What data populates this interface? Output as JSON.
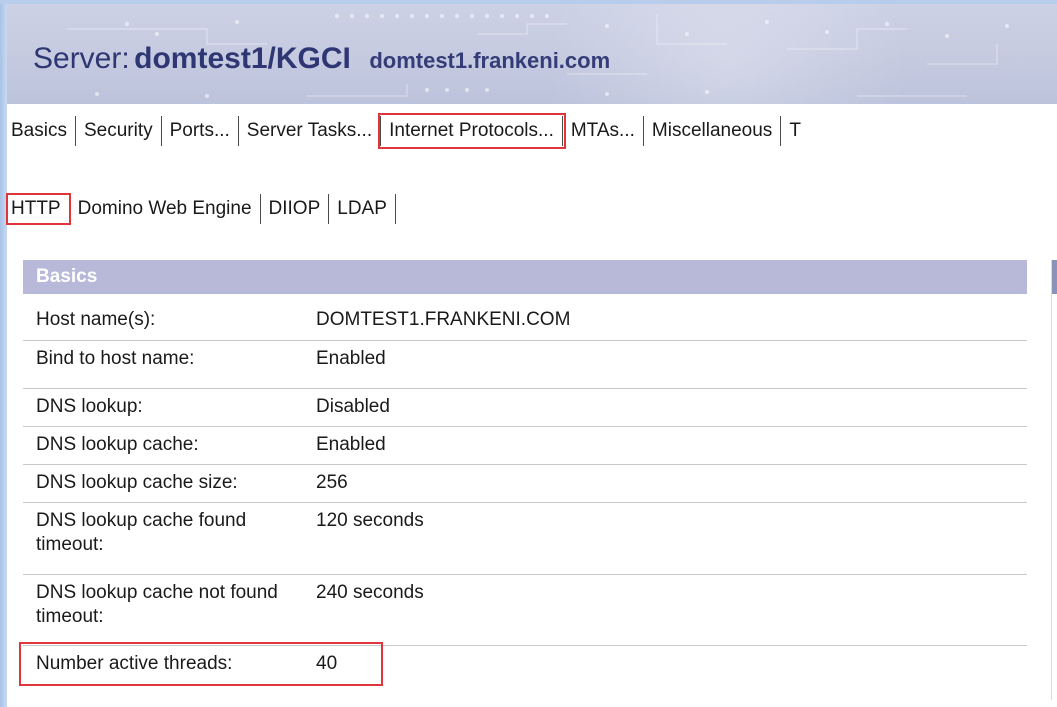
{
  "header": {
    "server_label": "Server:",
    "server_name": "domtest1/KGCI",
    "server_host": "domtest1.frankeni.com"
  },
  "main_tabs": [
    {
      "label": "Basics"
    },
    {
      "label": "Security"
    },
    {
      "label": "Ports..."
    },
    {
      "label": "Server Tasks..."
    },
    {
      "label": "Internet Protocols..."
    },
    {
      "label": "MTAs..."
    },
    {
      "label": "Miscellaneous"
    },
    {
      "label": "T"
    }
  ],
  "sub_tabs": [
    {
      "label": "HTTP"
    },
    {
      "label": "Domino Web Engine"
    },
    {
      "label": "DIIOP"
    },
    {
      "label": "LDAP"
    }
  ],
  "section": {
    "title": "Basics",
    "rows": [
      {
        "label": "Host name(s):",
        "value": "DOMTEST1.FRANKENI.COM"
      },
      {
        "label": "Bind to host name:",
        "value": "Enabled"
      },
      {
        "label": "DNS lookup:",
        "value": "Disabled"
      },
      {
        "label": "DNS lookup cache:",
        "value": "Enabled"
      },
      {
        "label": "DNS lookup cache size:",
        "value": "256"
      },
      {
        "label": "DNS lookup cache found timeout:",
        "value": "120 seconds"
      },
      {
        "label": "DNS lookup cache not found timeout:",
        "value": "240 seconds"
      },
      {
        "label": "Number active threads:",
        "value": "40"
      }
    ]
  },
  "colors": {
    "accent_red": "#e0353b",
    "section_header": "#b8b9d9",
    "title_text": "#2e3673"
  }
}
